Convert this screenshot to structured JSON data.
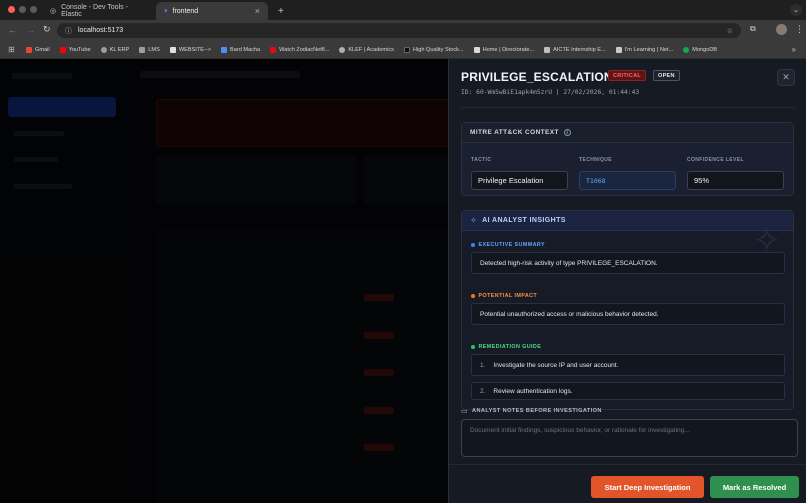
{
  "browser": {
    "tabs": [
      {
        "title": "Console - Dev Tools - Elastic"
      },
      {
        "title": "frontend"
      }
    ],
    "url": "localhost:5173",
    "bookmarks": [
      {
        "label": "Gmail",
        "color": "#ea4335"
      },
      {
        "label": "YouTube",
        "color": "#ff0000"
      },
      {
        "label": "KL ERP",
        "color": "#9e9e9e"
      },
      {
        "label": "LMS",
        "color": "#9e9e9e"
      },
      {
        "label": "WEBSITE-->",
        "color": "#e0e0e0"
      },
      {
        "label": "Bard Macha",
        "color": "#4f8ef7"
      },
      {
        "label": "Watch ZodiacNetfl...",
        "color": "#e50914"
      },
      {
        "label": "KLEF | Academics",
        "color": "#b0b0b0"
      },
      {
        "label": "High Quality Stock...",
        "color": "#222222"
      },
      {
        "label": "Home | Directorate...",
        "color": "#d9d9d9"
      },
      {
        "label": "AICTE Internship E...",
        "color": "#bdbdbd"
      },
      {
        "label": "I'm Learning | Net...",
        "color": "#c8c8c8"
      },
      {
        "label": "MongoDB",
        "color": "#13aa52"
      }
    ]
  },
  "alert": {
    "title": "PRIVILEGE_ESCALATION",
    "severity": "CRITICAL",
    "status": "OPEN",
    "meta": "ID: 60-Wm5wBiE1apk4m5zrU  |  27/02/2026, 01:44:43"
  },
  "mitre": {
    "heading": "MITRE ATT&CK CONTEXT",
    "tactic_label": "TACTIC",
    "tactic_value": "Privilege Escalation",
    "technique_label": "TECHNIQUE",
    "technique_value": "T1068",
    "confidence_label": "CONFIDENCE LEVEL",
    "confidence_value": "95%"
  },
  "ai": {
    "heading": "AI ANALYST INSIGHTS",
    "summary_label": "EXECUTIVE SUMMARY",
    "summary_text": "Detected high-risk activity of type PRIVILEGE_ESCALATION.",
    "impact_label": "POTENTIAL IMPACT",
    "impact_text": "Potential unauthorized access or malicious behavior detected.",
    "remediation_label": "REMEDIATION GUIDE",
    "steps": [
      {
        "num": "1.",
        "text": "Investigate the source IP and user account."
      },
      {
        "num": "2.",
        "text": "Review authentication logs."
      }
    ],
    "colors": {
      "summary": "#3b82f6",
      "impact": "#f97316",
      "remediation": "#22c55e"
    }
  },
  "notes": {
    "label": "ANALYST NOTES BEFORE INVESTIGATION",
    "placeholder": "Document initial findings, suspicious behavior, or rationale for investigating..."
  },
  "actions": {
    "deep_label": "Start Deep Investigation",
    "resolve_label": "Mark as Resolved"
  }
}
